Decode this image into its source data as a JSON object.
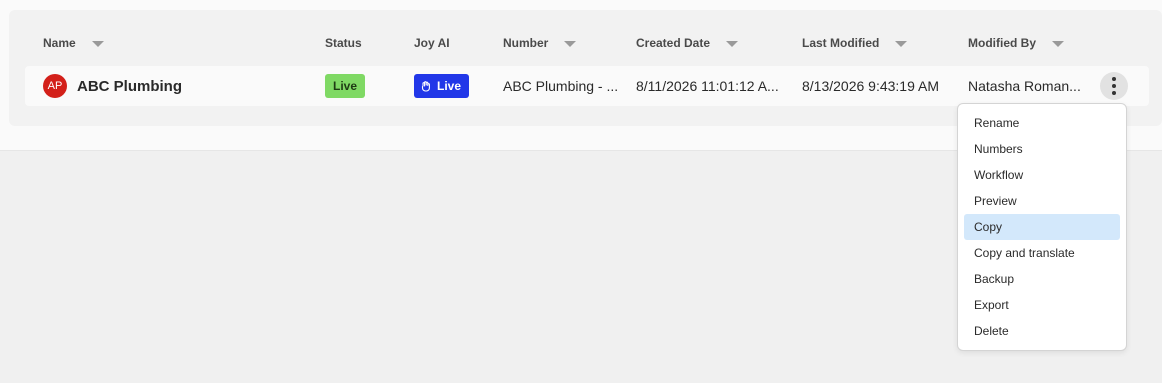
{
  "table": {
    "headers": {
      "name": "Name",
      "status": "Status",
      "joy_ai": "Joy AI",
      "number": "Number",
      "created_date": "Created Date",
      "last_modified": "Last Modified",
      "modified_by": "Modified By"
    },
    "rows": [
      {
        "avatar_initials": "AP",
        "name": "ABC Plumbing",
        "status": "Live",
        "joy_ai": "Live",
        "number": "ABC Plumbing - ...",
        "created_date": "8/11/2026 11:01:12 A...",
        "last_modified": "8/13/2026 9:43:19 AM",
        "modified_by": "Natasha Roman..."
      }
    ]
  },
  "context_menu": {
    "items": [
      "Rename",
      "Numbers",
      "Workflow",
      "Preview",
      "Copy",
      "Copy and translate",
      "Backup",
      "Export",
      "Delete"
    ],
    "highlighted": "Copy"
  },
  "colors": {
    "avatar": "#d3201a",
    "status_live": "#7fd964",
    "joy_ai_live": "#2137e8",
    "menu_highlight": "#d3e8fb"
  },
  "icons": {
    "sort": "chevron-down-icon",
    "joy_ai": "robot-hand-icon",
    "row_actions": "kebab-menu-icon"
  }
}
